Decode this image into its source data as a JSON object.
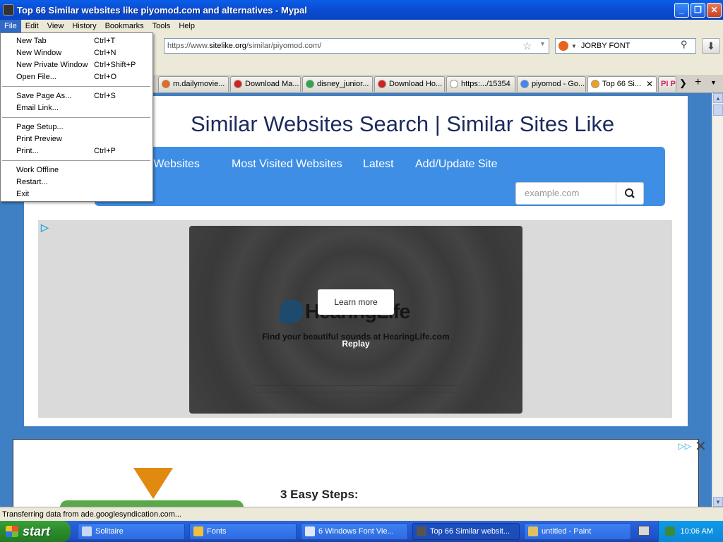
{
  "window": {
    "title": "Top 66 Similar websites like piyomod.com and alternatives - Mypal"
  },
  "menubar": [
    "File",
    "Edit",
    "View",
    "History",
    "Bookmarks",
    "Tools",
    "Help"
  ],
  "file_menu": {
    "items": [
      {
        "label": "New Tab",
        "shortcut": "Ctrl+T"
      },
      {
        "label": "New Window",
        "shortcut": "Ctrl+N"
      },
      {
        "label": "New Private Window",
        "shortcut": "Ctrl+Shift+P"
      },
      {
        "label": "Open File...",
        "shortcut": "Ctrl+O"
      },
      {
        "label": "Save Page As...",
        "shortcut": "Ctrl+S"
      },
      {
        "label": "Email Link...",
        "shortcut": ""
      },
      {
        "label": "Page Setup...",
        "shortcut": ""
      },
      {
        "label": "Print Preview",
        "shortcut": ""
      },
      {
        "label": "Print...",
        "shortcut": "Ctrl+P"
      },
      {
        "label": "Work Offline",
        "shortcut": ""
      },
      {
        "label": "Restart...",
        "shortcut": ""
      },
      {
        "label": "Exit",
        "shortcut": ""
      }
    ]
  },
  "navbar": {
    "url_prefix": "https://www.",
    "url_domain": "sitelike.org",
    "url_path": "/similar/piyomod.com/",
    "search_text": "JORBY FONT"
  },
  "tabs": [
    {
      "label": "m.dailymovie...",
      "fav_color": "#e86a1a"
    },
    {
      "label": "Download Ma...",
      "fav_color": "#d62020"
    },
    {
      "label": "disney_junior...",
      "fav_color": "#2aa84a"
    },
    {
      "label": "Download Ho...",
      "fav_color": "#d62020"
    },
    {
      "label": "https:.../15354",
      "fav_color": "#ffffff"
    },
    {
      "label": "piyomod - Go...",
      "fav_color": "#4285f4"
    },
    {
      "label": "Top 66 Si...",
      "fav_color": "#f0a020"
    },
    {
      "label": "PI P",
      "fav_color": "#d0206a"
    }
  ],
  "site": {
    "title": "Similar Websites Search | Similar Sites Like",
    "nav": [
      "p Websites",
      "Most Visited Websites",
      "Latest",
      "Add/Update Site"
    ],
    "search_placeholder": "example.com"
  },
  "ad": {
    "learn_more": "Learn more",
    "brand": "HearingLife",
    "tagline": "Find your beautiful sounds at HearingLife.com",
    "replay": "Replay"
  },
  "ad2": {
    "heading": "3 Easy Steps:"
  },
  "status": "Transferring data from ade.googlesyndication.com...",
  "taskbar": {
    "start": "start",
    "tasks": [
      {
        "label": "Solitaire",
        "icon_color": "#c8d8f0"
      },
      {
        "label": "Fonts",
        "icon_color": "#f0c040"
      },
      {
        "label": "6 Windows Font Vie...",
        "icon_color": "#e0e8f8"
      },
      {
        "label": "Top 66 Similar websit...",
        "icon_color": "#555555"
      },
      {
        "label": "untitled - Paint",
        "icon_color": "#e0c060"
      }
    ],
    "clock": "10:06 AM"
  },
  "colors": {
    "site_nav": "#3e8ee6",
    "page_bg": "#3f7fc4",
    "title_color": "#1c2a5e"
  }
}
